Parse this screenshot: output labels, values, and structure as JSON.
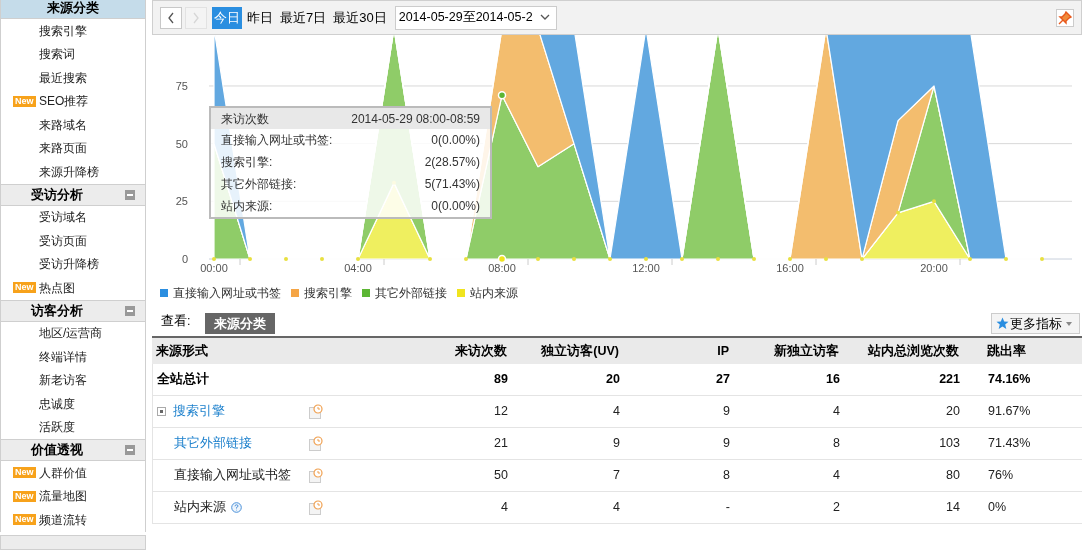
{
  "sidebar": {
    "sections": [
      {
        "title": "来源分类",
        "selected": true,
        "items": [
          {
            "label": "搜索引擎"
          },
          {
            "label": "搜索词"
          },
          {
            "label": "最近搜索"
          },
          {
            "label": "SEO推荐",
            "badge": "New"
          },
          {
            "label": "来路域名"
          },
          {
            "label": "来路页面"
          },
          {
            "label": "来源升降榜"
          }
        ]
      },
      {
        "title": "受访分析",
        "selected": false,
        "expanded": true,
        "items": [
          {
            "label": "受访域名"
          },
          {
            "label": "受访页面"
          },
          {
            "label": "受访升降榜"
          },
          {
            "label": "热点图",
            "badge": "New"
          }
        ]
      },
      {
        "title": "访客分析",
        "selected": false,
        "expanded": true,
        "items": [
          {
            "label": "地区/运营商"
          },
          {
            "label": "终端详情"
          },
          {
            "label": "新老访客"
          },
          {
            "label": "忠诚度"
          },
          {
            "label": "活跃度"
          }
        ]
      },
      {
        "title": "价值透视",
        "selected": false,
        "expanded": true,
        "items": [
          {
            "label": "人群价值",
            "badge": "New"
          },
          {
            "label": "流量地图",
            "badge": "New"
          },
          {
            "label": "频道流转",
            "badge": "New"
          }
        ]
      }
    ]
  },
  "toolbar": {
    "prev_disabled": false,
    "next_disabled": true,
    "ranges": [
      {
        "label": "今日",
        "selected": true
      },
      {
        "label": "昨日",
        "selected": false
      },
      {
        "label": "最近7日",
        "selected": false
      },
      {
        "label": "最近30日",
        "selected": false
      }
    ],
    "date_field": {
      "value": "2014-05-29至2014-05-2"
    }
  },
  "chart": {
    "y_labels": [
      "75",
      "50",
      "25",
      "0"
    ],
    "x_labels": [
      "00:00",
      "04:00",
      "08:00",
      "12:00",
      "16:00",
      "20:00"
    ],
    "legend": [
      {
        "name": "直接输入网址或书签",
        "color": "#2b8ee0"
      },
      {
        "name": "搜索引擎",
        "color": "#f5a545"
      },
      {
        "name": "其它外部链接",
        "color": "#5cb634"
      },
      {
        "name": "站内来源",
        "color": "#f0e41e"
      }
    ],
    "tooltip": {
      "title": "来访次数",
      "time": "2014-05-29 08:00-08:59",
      "rows": [
        {
          "label": "直接输入网址或书签:",
          "value": "0(0.00%)"
        },
        {
          "label": "搜索引擎:",
          "value": "2(28.57%)"
        },
        {
          "label": "其它外部链接:",
          "value": "5(71.43%)"
        },
        {
          "label": "站内来源:",
          "value": "0(0.00%)"
        }
      ]
    }
  },
  "view": {
    "label": "查看:",
    "tab": "来源分类",
    "more_button": "更多指标"
  },
  "table": {
    "columns": [
      "来源形式",
      "来访次数",
      "独立访客(UV)",
      "IP",
      "新独立访客",
      "站内总浏览次数",
      "跳出率"
    ],
    "rows": [
      {
        "kind": "total",
        "cells": [
          "全站总计",
          "89",
          "20",
          "27",
          "16",
          "221",
          "74.16%"
        ]
      },
      {
        "kind": "expandable",
        "cells": [
          "搜索引擎",
          "12",
          "4",
          "9",
          "4",
          "20",
          "91.67%"
        ]
      },
      {
        "kind": "link",
        "cells": [
          "其它外部链接",
          "21",
          "9",
          "9",
          "8",
          "103",
          "71.43%"
        ]
      },
      {
        "kind": "plain",
        "cells": [
          "直接输入网址或书签",
          "50",
          "7",
          "8",
          "4",
          "80",
          "76%"
        ]
      },
      {
        "kind": "help",
        "cells": [
          "站内来源",
          "4",
          "4",
          "-",
          "2",
          "14",
          "0%"
        ]
      }
    ]
  }
}
